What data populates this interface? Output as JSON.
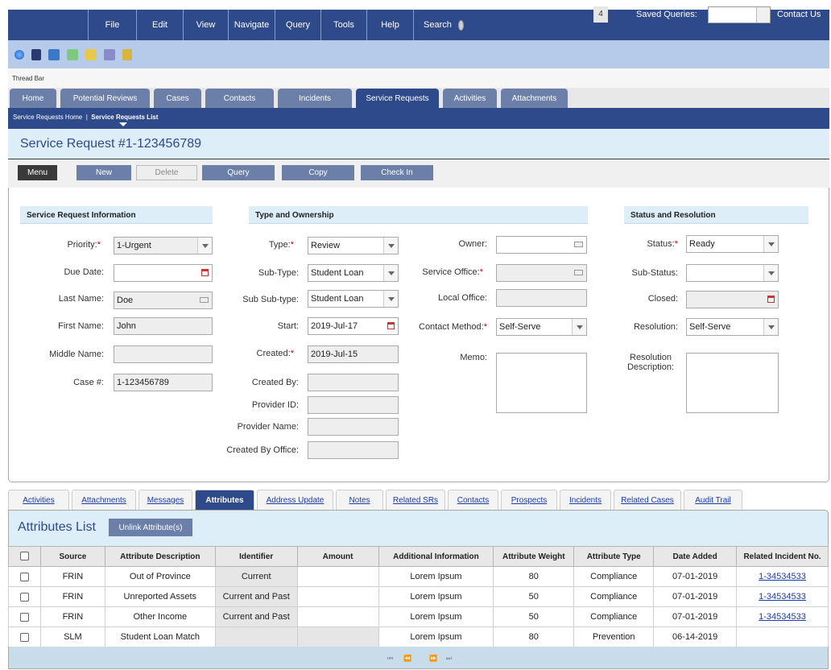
{
  "menubar": {
    "items": [
      "File",
      "Edit",
      "View",
      "Navigate",
      "Query",
      "Tools",
      "Help"
    ],
    "search_label": "Search",
    "badge_count": "4",
    "saved_queries_label": "Saved Queries:",
    "contact_us": "Contact Us"
  },
  "thread_bar": "Thread Bar",
  "screen_tabs": [
    "Home",
    "Potential Reviews",
    "Cases",
    "Contacts",
    "Incidents",
    "Service Requests",
    "Activities",
    "Attachments"
  ],
  "active_screen_tab": "Service Requests",
  "breadcrumb": {
    "home": "Service Requests Home",
    "sep": "|",
    "current": "Service Requests List"
  },
  "page_title": "Service Request #1-123456789",
  "actions": {
    "menu": "Menu",
    "new": "New",
    "delete": "Delete",
    "query": "Query",
    "copy": "Copy",
    "check_in": "Check In"
  },
  "sections": {
    "sr_info": "Service Request Information",
    "type_ownership": "Type and Ownership",
    "status_resolution": "Status and Resolution"
  },
  "fields": {
    "priority": {
      "label": "Priority:",
      "value": "1-Urgent"
    },
    "due_date": {
      "label": "Due Date:",
      "value": ""
    },
    "last_name": {
      "label": "Last Name:",
      "value": "Doe"
    },
    "first_name": {
      "label": "First Name:",
      "value": "John"
    },
    "middle_name": {
      "label": "Middle Name:",
      "value": ""
    },
    "case_num": {
      "label": "Case #:",
      "value": "1-123456789"
    },
    "type": {
      "label": "Type:",
      "value": "Review"
    },
    "sub_type": {
      "label": "Sub-Type:",
      "value": "Student Loan"
    },
    "sub_sub_type": {
      "label": "Sub Sub-type:",
      "value": "Student Loan"
    },
    "start": {
      "label": "Start:",
      "value": "2019-Jul-17"
    },
    "created": {
      "label": "Created:",
      "value": "2019-Jul-15"
    },
    "created_by": {
      "label": "Created By:",
      "value": ""
    },
    "provider_id": {
      "label": "Provider ID:",
      "value": ""
    },
    "provider_name": {
      "label": "Provider Name:",
      "value": ""
    },
    "created_by_office": {
      "label": "Created By Office:",
      "value": ""
    },
    "owner": {
      "label": "Owner:",
      "value": ""
    },
    "service_office": {
      "label": "Service Office:",
      "value": ""
    },
    "local_office": {
      "label": "Local Office:",
      "value": ""
    },
    "contact_method": {
      "label": "Contact Method:",
      "value": "Self-Serve"
    },
    "memo": {
      "label": "Memo:",
      "value": ""
    },
    "status": {
      "label": "Status:",
      "value": "Ready"
    },
    "sub_status": {
      "label": "Sub-Status:",
      "value": ""
    },
    "closed": {
      "label": "Closed:",
      "value": ""
    },
    "resolution": {
      "label": "Resolution:",
      "value": "Self-Serve"
    },
    "resolution_desc": {
      "label": "Resolution Description:",
      "value": ""
    }
  },
  "view_tabs": [
    "Activities",
    "Attachments",
    "Messages",
    "Attributes",
    "Address Update",
    "Notes",
    "Related SRs",
    "Contacts",
    "Prospects",
    "Incidents",
    "Related Cases",
    "Audit Trail"
  ],
  "active_view_tab": "Attributes",
  "list": {
    "title": "Attributes List",
    "unlink_button": "Unlink Attribute(s)",
    "columns": [
      "Source",
      "Attribute Description",
      "Identifier",
      "Amount",
      "Additional Information",
      "Attribute Weight",
      "Attribute Type",
      "Date Added",
      "Related Incident No."
    ],
    "rows": [
      [
        "FRIN",
        "Out of Province",
        "Current",
        "",
        "Lorem Ipsum",
        "80",
        "Compliance",
        "07-01-2019",
        "1-34534533"
      ],
      [
        "FRIN",
        "Unreported Assets",
        "Current and Past",
        "",
        "Lorem Ipsum",
        "50",
        "Compliance",
        "07-01-2019",
        "1-34534533"
      ],
      [
        "FRIN",
        "Other Income",
        "Current and Past",
        "",
        "Lorem Ipsum",
        "50",
        "Compliance",
        "07-01-2019",
        "1-34534533"
      ],
      [
        "SLM",
        "Student Loan Match",
        "",
        "",
        "Lorem Ipsum",
        "80",
        "Prevention",
        "06-14-2019",
        ""
      ]
    ]
  },
  "pager": {
    "first": "⏮",
    "prev": "⏪",
    "next": "⏩",
    "last": "⏭"
  }
}
